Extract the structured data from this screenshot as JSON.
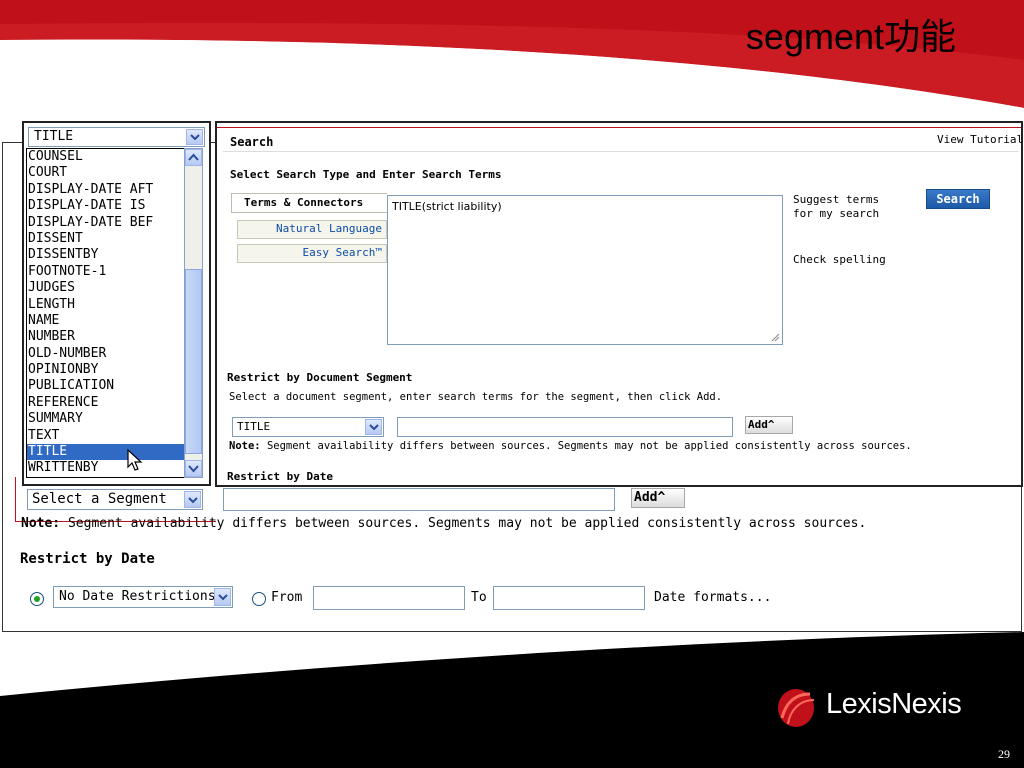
{
  "slide": {
    "title": "segment功能",
    "page_number": "29",
    "logo_text": "LexisNexis",
    "colors": {
      "accent_red": "#c0101a",
      "band_black": "#000000",
      "link_blue": "#0b4ca8",
      "selected_blue": "#316ac5"
    }
  },
  "background_form": {
    "select_segment": "Select a Segment",
    "add_label": "Add",
    "note_label": "Note:",
    "note_text": "Segment availability differs between sources. Segments may not be applied consistently across sources.",
    "restrict_date_heading": "Restrict by Date",
    "date_option": "No Date Restrictions",
    "from_label": "From",
    "to_label": "To",
    "date_formats_link": "Date formats..."
  },
  "search_panel": {
    "title": "Search",
    "view_tutorial": "View Tutorial",
    "subtitle": "Select Search Type and Enter Search Terms",
    "tabs": [
      {
        "label": "Terms & Connectors"
      },
      {
        "label": "Natural Language"
      },
      {
        "label": "Easy Search™"
      }
    ],
    "query_text": "TITLE(strict liability)",
    "suggest_terms_1": "Suggest terms",
    "suggest_terms_2": "for my search",
    "check_spelling": "Check spelling",
    "search_button": "Search",
    "restrict_segment_heading": "Restrict by Document Segment",
    "restrict_segment_instructions": "Select a document segment, enter search terms for the segment, then click Add.",
    "segment_value": "TITLE",
    "add_label": "Add",
    "note_label": "Note:",
    "note_text": "Segment availability differs between sources. Segments may not be applied consistently across sources.",
    "restrict_date_heading": "Restrict by Date"
  },
  "segment_dropdown": {
    "selected_value": "TITLE",
    "options": [
      "COUNSEL",
      "COURT",
      "DISPLAY-DATE AFT",
      "DISPLAY-DATE IS",
      "DISPLAY-DATE BEF",
      "DISSENT",
      "DISSENTBY",
      "FOOTNOTE-1",
      "JUDGES",
      "LENGTH",
      "NAME",
      "NUMBER",
      "OLD-NUMBER",
      "OPINIONBY",
      "PUBLICATION",
      "REFERENCE",
      "SUMMARY",
      "TEXT",
      "TITLE",
      "WRITTENBY"
    ],
    "highlighted_option": "TITLE"
  }
}
